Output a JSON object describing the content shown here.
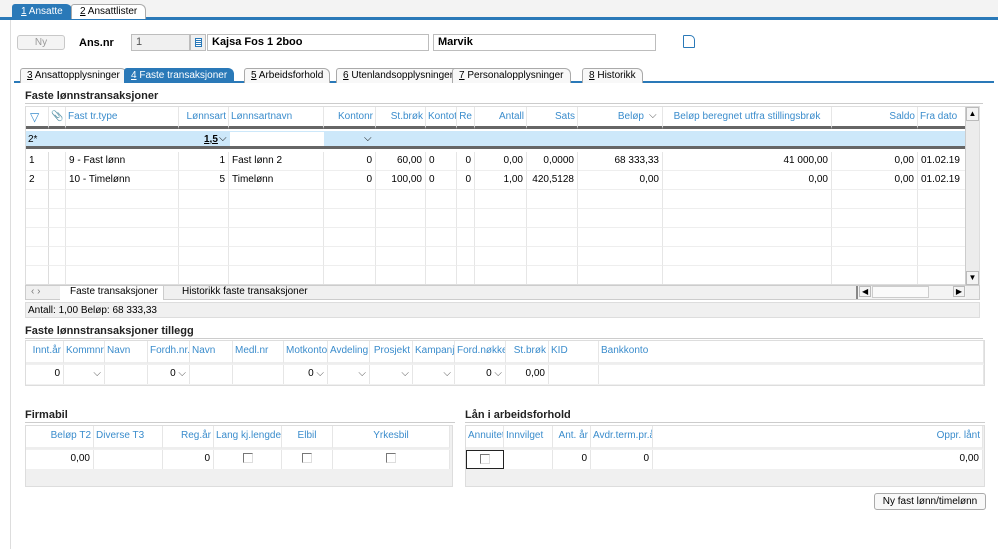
{
  "top_tabs": [
    {
      "num": "1",
      "label": " Ansatte"
    },
    {
      "num": "2",
      "label": " Ansattlister"
    }
  ],
  "header": {
    "new_button": "Ny",
    "ansnr_label": "Ans.nr",
    "ansnr_value": "1",
    "first_name": "Kajsa Fos  1 2boo",
    "last_name": "Marvik"
  },
  "sub_tabs": [
    {
      "num": "3",
      "label": " Ansattopplysninger"
    },
    {
      "num": "4",
      "label": " Faste transaksjoner"
    },
    {
      "num": "5",
      "label": " Arbeidsforhold"
    },
    {
      "num": "6",
      "label": " Utenlandsopplysninger"
    },
    {
      "num": "7",
      "label": " Personalopplysninger"
    },
    {
      "num": "8",
      "label": " Historikk"
    }
  ],
  "main_grid": {
    "title": "Faste lønnstransaksjoner",
    "columns": [
      "",
      "",
      "Fast tr.type",
      "Lønnsart",
      "Lønnsartnavn",
      "Kontonr",
      "St.brøk",
      "Kontot",
      "Re",
      "Antall",
      "Sats",
      "Beløp",
      "Beløp beregnet utfra stillingsbrøk",
      "Saldo",
      "Fra dato"
    ],
    "new_row": {
      "num": "2*",
      "lonnsart": "1,5"
    },
    "rows": [
      [
        "1",
        "",
        "9 - Fast lønn",
        "1",
        "Fast lønn 2",
        "0",
        "60,00",
        "0",
        "0",
        "0,00",
        "0,0000",
        "68 333,33",
        "41 000,00",
        "0,00",
        "01.02.19"
      ],
      [
        "2",
        "",
        "10 - Timelønn",
        "5",
        "Timelønn",
        "0",
        "100,00",
        "0",
        "0",
        "1,00",
        "420,5128",
        "0,00",
        "0,00",
        "0,00",
        "01.02.19"
      ]
    ],
    "bottom_tabs": [
      "Faste transaksjoner",
      "Historikk faste transaksjoner"
    ],
    "status": "Antall: 1,00  Beløp: 68 333,33"
  },
  "tillegg": {
    "title": "Faste lønnstransaksjoner tillegg",
    "columns": [
      "Innt.år",
      "Kommnr",
      "Navn",
      "Fordh.nr.",
      "Navn",
      "Medl.nr",
      "Motkonto",
      "Avdeling",
      "Prosjekt",
      "Kampanj",
      "Ford.nøkkel",
      "St.brøk",
      "KID",
      "Bankkonto"
    ],
    "row": [
      "0",
      "",
      "",
      "0",
      "",
      "",
      "0",
      "",
      "",
      "",
      "0",
      "0,00",
      "",
      ""
    ]
  },
  "firmabil": {
    "title": "Firmabil",
    "columns": [
      "Beløp T2",
      "Diverse T3",
      "Reg.år",
      "Lang kj.lengde",
      "Elbil",
      "Yrkesbil"
    ],
    "row": [
      "0,00",
      "",
      "0",
      "",
      "",
      ""
    ]
  },
  "lan": {
    "title": "Lån i arbeidsforhold",
    "columns": [
      "Annuitet",
      "Innvilget",
      "Ant. år",
      "Avdr.term.pr.år",
      "Oppr. lånt"
    ],
    "row": [
      "",
      "",
      "0",
      "0",
      "0,00"
    ]
  },
  "new_fixed_button": "Ny fast lønn/timelønn"
}
